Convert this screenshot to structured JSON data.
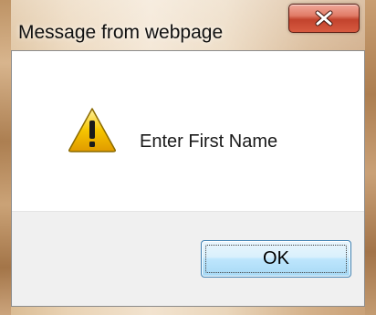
{
  "window": {
    "title": "Message from webpage",
    "close_icon": "close-icon"
  },
  "dialog": {
    "icon": "warning-icon",
    "message": "Enter First Name",
    "ok_label": "OK"
  },
  "colors": {
    "close_button": "#c2432d",
    "ok_button_border": "#3c7fb1",
    "footer_bg": "#f0f0f0",
    "warning_yellow": "#f6c500"
  }
}
